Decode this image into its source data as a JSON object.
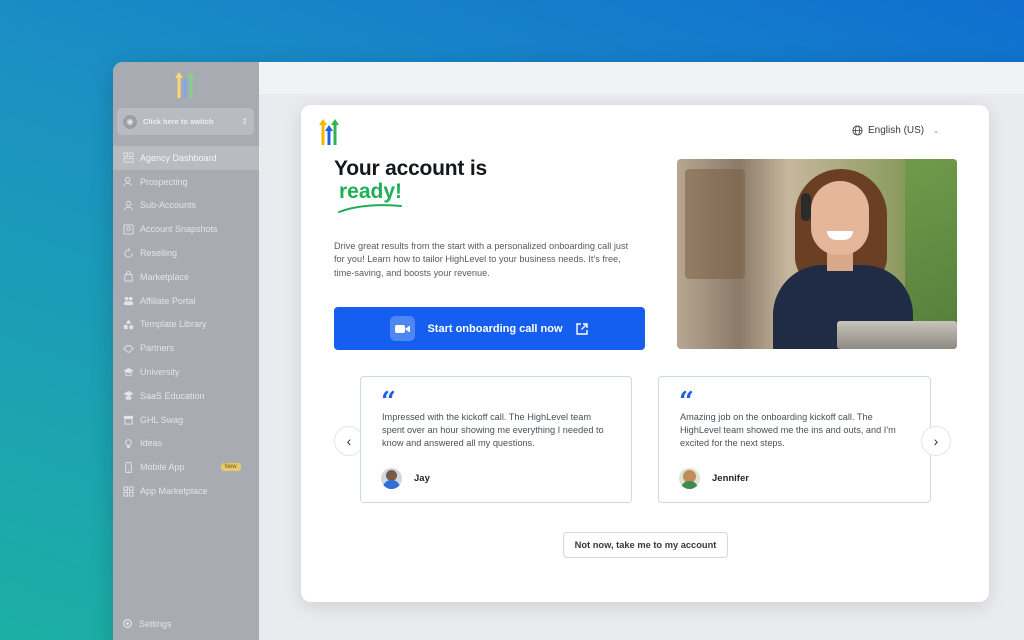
{
  "sidebar": {
    "switcher_label": "Click here to switch",
    "items": [
      {
        "label": "Agency Dashboard",
        "icon": "dashboard-icon",
        "active": true
      },
      {
        "label": "Prospecting",
        "icon": "prospecting-icon"
      },
      {
        "label": "Sub-Accounts",
        "icon": "user-icon"
      },
      {
        "label": "Account Snapshots",
        "icon": "snapshot-icon"
      },
      {
        "label": "Reselling",
        "icon": "refresh-icon"
      },
      {
        "label": "Marketplace",
        "icon": "bag-icon"
      },
      {
        "label": "Affiliate Portal",
        "icon": "users-icon"
      },
      {
        "label": "Template Library",
        "icon": "shapes-icon"
      },
      {
        "label": "Partners",
        "icon": "handshake-icon"
      },
      {
        "label": "University",
        "icon": "graduation-cap-icon"
      },
      {
        "label": "SaaS Education",
        "icon": "education-icon"
      },
      {
        "label": "GHL Swag",
        "icon": "store-icon"
      },
      {
        "label": "Ideas",
        "icon": "bulb-icon"
      },
      {
        "label": "Mobile App",
        "icon": "phone-icon",
        "badge": "New"
      },
      {
        "label": "App Marketplace",
        "icon": "grid-icon"
      }
    ],
    "settings_label": "Settings"
  },
  "modal": {
    "language": "English (US)",
    "title_line1": "Your account is",
    "title_line2": "ready!",
    "description": "Drive great results from the start with a personalized onboarding call just for you! Learn how to tailor HighLevel to your business needs. It's free, time-saving, and boosts your revenue.",
    "cta_label": "Start onboarding call now",
    "testimonials": [
      {
        "text": "Impressed with the kickoff call. The HighLevel team spent over an hour showing me everything I needed to know and answered all my questions.",
        "author": "Jay"
      },
      {
        "text": "Amazing job on the onboarding kickoff call. The HighLevel team showed me the ins and outs, and I'm excited for the next steps.",
        "author": "Jennifer"
      }
    ],
    "skip_label": "Not now, take me to my account"
  },
  "colors": {
    "primary": "#155eef",
    "accent_green": "#1fae58",
    "logo_yellow": "#f5b800",
    "logo_blue": "#1f5fe0",
    "logo_green": "#2fb34f"
  }
}
